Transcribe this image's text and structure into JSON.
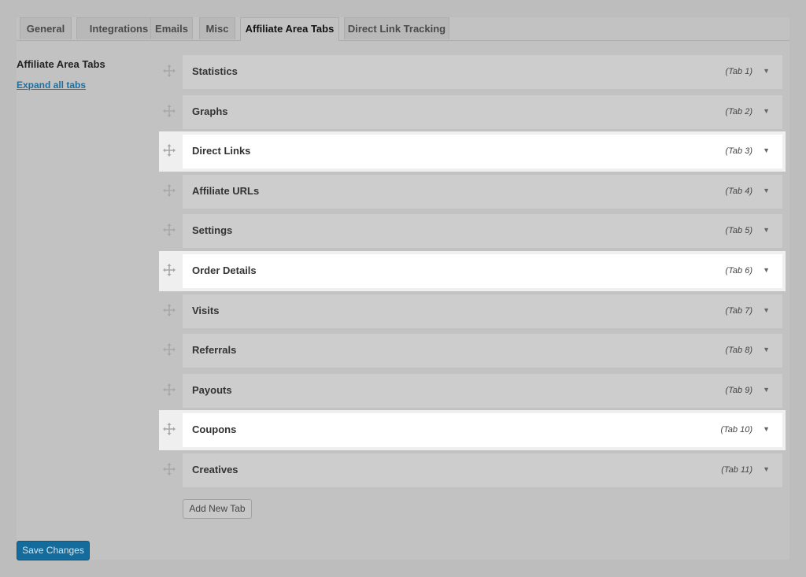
{
  "tabs": [
    {
      "label": "General",
      "active": false
    },
    {
      "label": "Integrations",
      "active": false
    },
    {
      "label": "Emails",
      "active": false
    },
    {
      "label": "Misc",
      "active": false
    },
    {
      "label": "Affiliate Area Tabs",
      "active": true
    },
    {
      "label": "Direct Link Tracking",
      "active": false
    }
  ],
  "section": {
    "title": "Affiliate Area Tabs",
    "expand_link": "Expand all tabs"
  },
  "rows": [
    {
      "label": "Statistics",
      "num": "(Tab 1)",
      "highlighted": false
    },
    {
      "label": "Graphs",
      "num": "(Tab 2)",
      "highlighted": false
    },
    {
      "label": "Direct Links",
      "num": "(Tab 3)",
      "highlighted": true
    },
    {
      "label": "Affiliate URLs",
      "num": "(Tab 4)",
      "highlighted": false
    },
    {
      "label": "Settings",
      "num": "(Tab 5)",
      "highlighted": false
    },
    {
      "label": "Order Details",
      "num": "(Tab 6)",
      "highlighted": true
    },
    {
      "label": "Visits",
      "num": "(Tab 7)",
      "highlighted": false
    },
    {
      "label": "Referrals",
      "num": "(Tab 8)",
      "highlighted": false
    },
    {
      "label": "Payouts",
      "num": "(Tab 9)",
      "highlighted": false
    },
    {
      "label": "Coupons",
      "num": "(Tab 10)",
      "highlighted": true
    },
    {
      "label": "Creatives",
      "num": "(Tab 11)",
      "highlighted": false
    }
  ],
  "icons": {
    "handle": "move-icon",
    "arrow": "caret-down-icon",
    "arrow_glyph": "▼"
  },
  "buttons": {
    "add_new_tab": "Add New Tab",
    "save_changes": "Save Changes"
  },
  "colors": {
    "primary_button": "#136c9c",
    "link": "#1f6f9c",
    "highlight_row": "#ffffff"
  }
}
